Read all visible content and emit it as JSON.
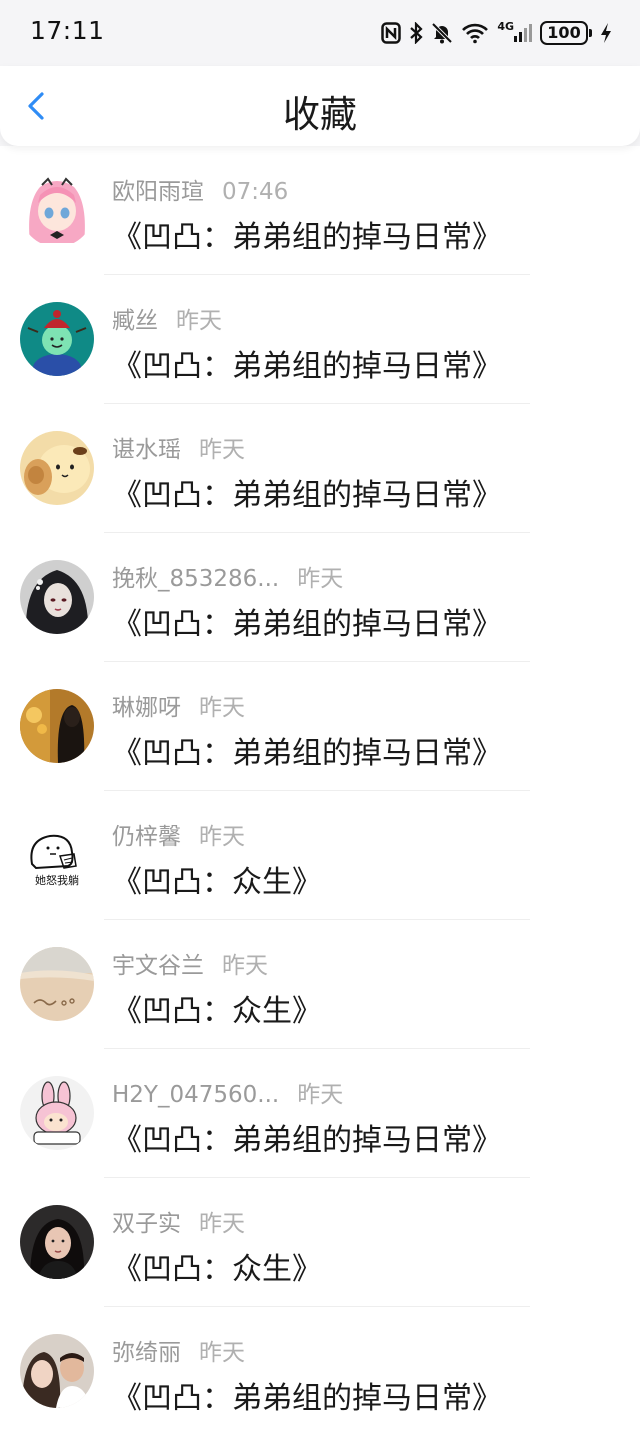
{
  "status_bar": {
    "time": "17:11",
    "network": "4G",
    "battery": "100",
    "icons": [
      "nfc-icon",
      "bluetooth-icon",
      "mute-bell-icon",
      "wifi-icon",
      "signal-icon",
      "battery-icon",
      "charging-icon"
    ]
  },
  "header": {
    "title": "收藏",
    "back_icon": "chevron-left-icon",
    "accent_color": "#2f8cf5"
  },
  "items": [
    {
      "name": "欧阳雨瑄",
      "time": "07:46",
      "content": "《凹凸：弟弟组的掉马日常》"
    },
    {
      "name": "臧丝",
      "time": "昨天",
      "content": "《凹凸：弟弟组的掉马日常》"
    },
    {
      "name": "谌水瑶",
      "time": "昨天",
      "content": "《凹凸：弟弟组的掉马日常》"
    },
    {
      "name": "挽秋_853286...",
      "time": "昨天",
      "content": "《凹凸：弟弟组的掉马日常》"
    },
    {
      "name": "琳娜呀",
      "time": "昨天",
      "content": "《凹凸：弟弟组的掉马日常》"
    },
    {
      "name": "仍梓馨",
      "time": "昨天",
      "content": "《凹凸：众生》"
    },
    {
      "name": "宇文谷兰",
      "time": "昨天",
      "content": "《凹凸：众生》"
    },
    {
      "name": "H2Y_047560...",
      "time": "昨天",
      "content": "《凹凸：弟弟组的掉马日常》"
    },
    {
      "name": "双子实",
      "time": "昨天",
      "content": "《凹凸：众生》"
    },
    {
      "name": "弥绮丽",
      "time": "昨天",
      "content": "《凹凸：弟弟组的掉马日常》"
    }
  ],
  "sticker_text": "她怒我躺"
}
